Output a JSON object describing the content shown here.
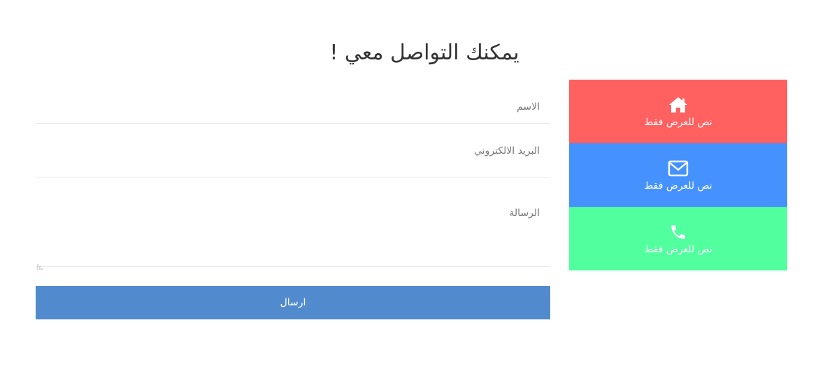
{
  "header": {
    "title": "يمكنك التواصل معي !"
  },
  "info_boxes": [
    {
      "icon": "home-icon",
      "text": "نص للعرض فقط",
      "color": "#ff6060"
    },
    {
      "icon": "envelope-icon",
      "text": "نص للعرض فقط",
      "color": "#4592ff"
    },
    {
      "icon": "phone-icon",
      "text": "نص للعرض فقط",
      "color": "#51ff9e"
    }
  ],
  "form": {
    "name_placeholder": "الاسم",
    "name_value": "",
    "email_placeholder": "البريد الالكتروني",
    "email_value": "",
    "message_placeholder": "الرسالة",
    "message_value": "",
    "submit_label": "ارسال",
    "submit_color": "#528bcd"
  }
}
